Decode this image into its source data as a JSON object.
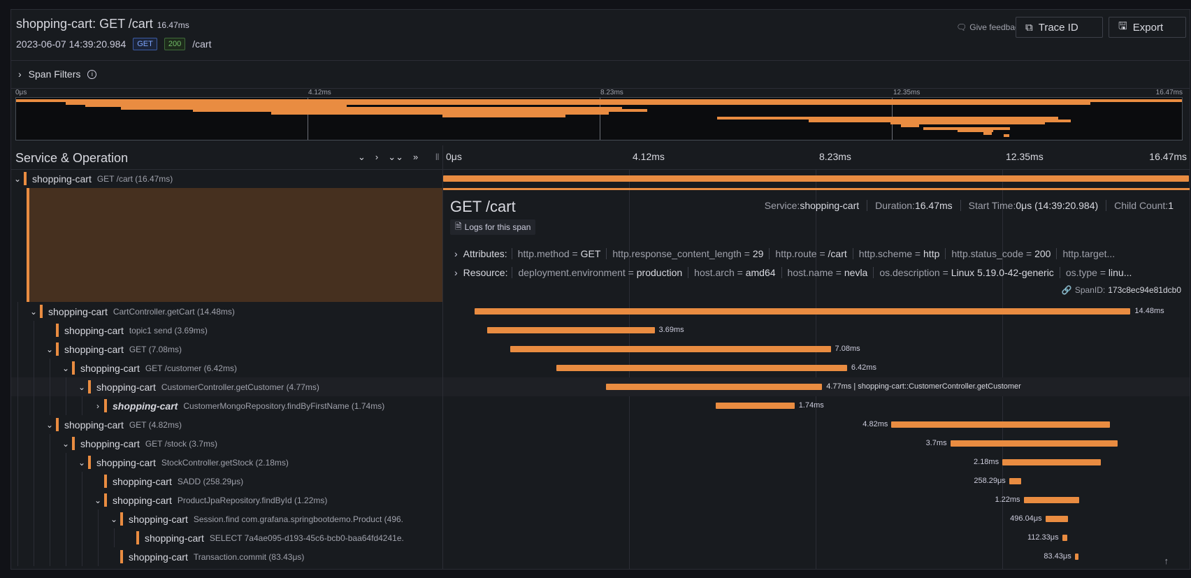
{
  "header": {
    "title": "shopping-cart: GET /cart",
    "duration": "16.47ms",
    "timestamp": "2023-06-07 14:39:20.984",
    "method": "GET",
    "status": "200",
    "path": "/cart",
    "feedback": "Give feedback",
    "trace_id_label": "Trace ID",
    "export_label": "Export"
  },
  "filters": {
    "label": "Span Filters"
  },
  "minimap": {
    "ticks": [
      "0μs",
      "4.12ms",
      "8.23ms",
      "12.35ms",
      "16.47ms"
    ]
  },
  "columns": {
    "service_operation": "Service & Operation",
    "ticks": [
      "0μs",
      "4.12ms",
      "8.23ms",
      "12.35ms",
      "16.47ms"
    ]
  },
  "total_ms": 16.47,
  "spans": [
    {
      "svc": "shopping-cart",
      "op": "GET /cart (16.47ms)",
      "depth": 0,
      "chev": "⌄",
      "start": 0,
      "dur": 16.47,
      "label": ""
    },
    {
      "svc": "shopping-cart",
      "op": "CartController.getCart (14.48ms)",
      "depth": 1,
      "chev": "⌄",
      "start": 0.7,
      "dur": 14.48,
      "label": "14.48ms",
      "side": "right"
    },
    {
      "svc": "shopping-cart",
      "op": "topic1 send (3.69ms)",
      "depth": 2,
      "chev": "",
      "start": 0.98,
      "dur": 3.69,
      "label": "3.69ms",
      "side": "right"
    },
    {
      "svc": "shopping-cart",
      "op": "GET (7.08ms)",
      "depth": 2,
      "chev": "⌄",
      "start": 1.48,
      "dur": 7.08,
      "label": "7.08ms",
      "side": "right"
    },
    {
      "svc": "shopping-cart",
      "op": "GET /customer (6.42ms)",
      "depth": 3,
      "chev": "⌄",
      "start": 2.5,
      "dur": 6.42,
      "label": "6.42ms",
      "side": "right"
    },
    {
      "svc": "shopping-cart",
      "op": "CustomerController.getCustomer (4.77ms)",
      "depth": 4,
      "chev": "⌄",
      "start": 3.6,
      "dur": 4.77,
      "label": "4.77ms | shopping-cart::CustomerController.getCustomer",
      "side": "right",
      "selected": true
    },
    {
      "svc": "shopping-cart",
      "op": "CustomerMongoRepository.findByFirstName (1.74ms)",
      "depth": 5,
      "chev": "›",
      "start": 6.02,
      "dur": 1.74,
      "label": "1.74ms",
      "side": "right",
      "bold": true
    },
    {
      "svc": "shopping-cart",
      "op": "GET (4.82ms)",
      "depth": 2,
      "chev": "⌄",
      "start": 9.9,
      "dur": 4.82,
      "label": "4.82ms",
      "side": "left"
    },
    {
      "svc": "shopping-cart",
      "op": "GET /stock (3.7ms)",
      "depth": 3,
      "chev": "⌄",
      "start": 11.2,
      "dur": 3.7,
      "label": "3.7ms",
      "side": "left"
    },
    {
      "svc": "shopping-cart",
      "op": "StockController.getStock (2.18ms)",
      "depth": 4,
      "chev": "⌄",
      "start": 12.35,
      "dur": 2.18,
      "label": "2.18ms",
      "side": "left"
    },
    {
      "svc": "shopping-cart",
      "op": "SADD (258.29μs)",
      "depth": 5,
      "chev": "",
      "start": 12.5,
      "dur": 0.26,
      "label": "258.29μs",
      "side": "left"
    },
    {
      "svc": "shopping-cart",
      "op": "ProductJpaRepository.findById (1.22ms)",
      "depth": 5,
      "chev": "⌄",
      "start": 12.82,
      "dur": 1.22,
      "label": "1.22ms",
      "side": "left"
    },
    {
      "svc": "shopping-cart",
      "op": "Session.find com.grafana.springbootdemo.Product (496.",
      "depth": 6,
      "chev": "⌄",
      "start": 13.3,
      "dur": 0.5,
      "label": "496.04μs",
      "side": "left"
    },
    {
      "svc": "shopping-cart",
      "op": "SELECT 7a4ae095-d193-45c6-bcb0-baa64fd4241e.",
      "depth": 7,
      "chev": "",
      "start": 13.67,
      "dur": 0.11,
      "label": "112.33μs",
      "side": "left"
    },
    {
      "svc": "shopping-cart",
      "op": "Transaction.commit (83.43μs)",
      "depth": 6,
      "chev": "",
      "start": 13.95,
      "dur": 0.08,
      "label": "83.43μs",
      "side": "left"
    }
  ],
  "detail": {
    "name": "GET /cart",
    "service_key": "Service:",
    "service_val": "shopping-cart",
    "duration_key": "Duration:",
    "duration_val": "16.47ms",
    "start_key": "Start Time:",
    "start_val": "0μs (14:39:20.984)",
    "child_key": "Child Count:",
    "child_val": "1",
    "logs_label": "Logs for this span",
    "attributes_key": "Attributes:",
    "attributes": [
      {
        "k": "http.method",
        "v": "GET"
      },
      {
        "k": "http.response_content_length",
        "v": "29"
      },
      {
        "k": "http.route",
        "v": "/cart"
      },
      {
        "k": "http.scheme",
        "v": "http"
      },
      {
        "k": "http.status_code",
        "v": "200"
      },
      {
        "k": "http.target...",
        "v": ""
      }
    ],
    "resource_key": "Resource:",
    "resource": [
      {
        "k": "deployment.environment",
        "v": "production"
      },
      {
        "k": "host.arch",
        "v": "amd64"
      },
      {
        "k": "host.name",
        "v": "nevla"
      },
      {
        "k": "os.description",
        "v": "Linux 5.19.0-42-generic"
      },
      {
        "k": "os.type",
        "v": "linu..."
      }
    ],
    "spanid_key": "SpanID:",
    "spanid_val": "173c8ec94e81dcb0"
  },
  "colors": {
    "bar": "#e98c41",
    "bg": "#181b1f",
    "selected_fill": "#46301f"
  }
}
